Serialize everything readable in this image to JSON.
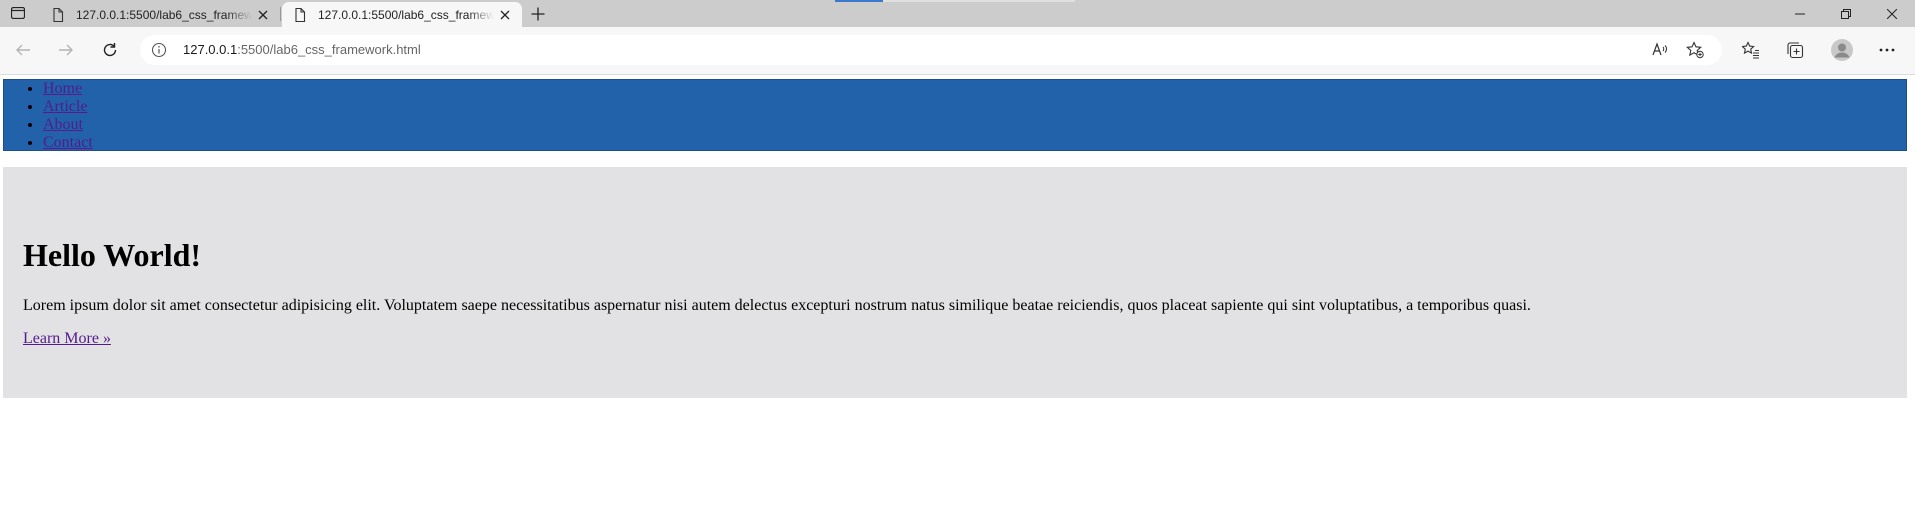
{
  "browser": {
    "tabs": [
      {
        "title": "127.0.0.1:5500/lab6_css_framewo",
        "active": false
      },
      {
        "title": "127.0.0.1:5500/lab6_css_framewo",
        "active": true
      }
    ],
    "address": {
      "host": "127.0.0.1",
      "rest": ":5500/lab6_css_framework.html"
    }
  },
  "page": {
    "nav": [
      "Home",
      "Article",
      "About",
      "Contact"
    ],
    "hero": {
      "heading": "Hello World!",
      "text": "Lorem ipsum dolor sit amet consectetur adipisicing elit. Voluptatem saepe necessitatibus aspernatur nisi autem delectus excepturi nostrum natus similique beatae reiciendis, quos placeat sapiente qui sint voluptatibus, a temporibus quasi.",
      "link": "Learn More »"
    }
  },
  "colors": {
    "nav_background": "#2162ab",
    "hero_background": "#e2e2e4",
    "link": "#551a8b"
  }
}
